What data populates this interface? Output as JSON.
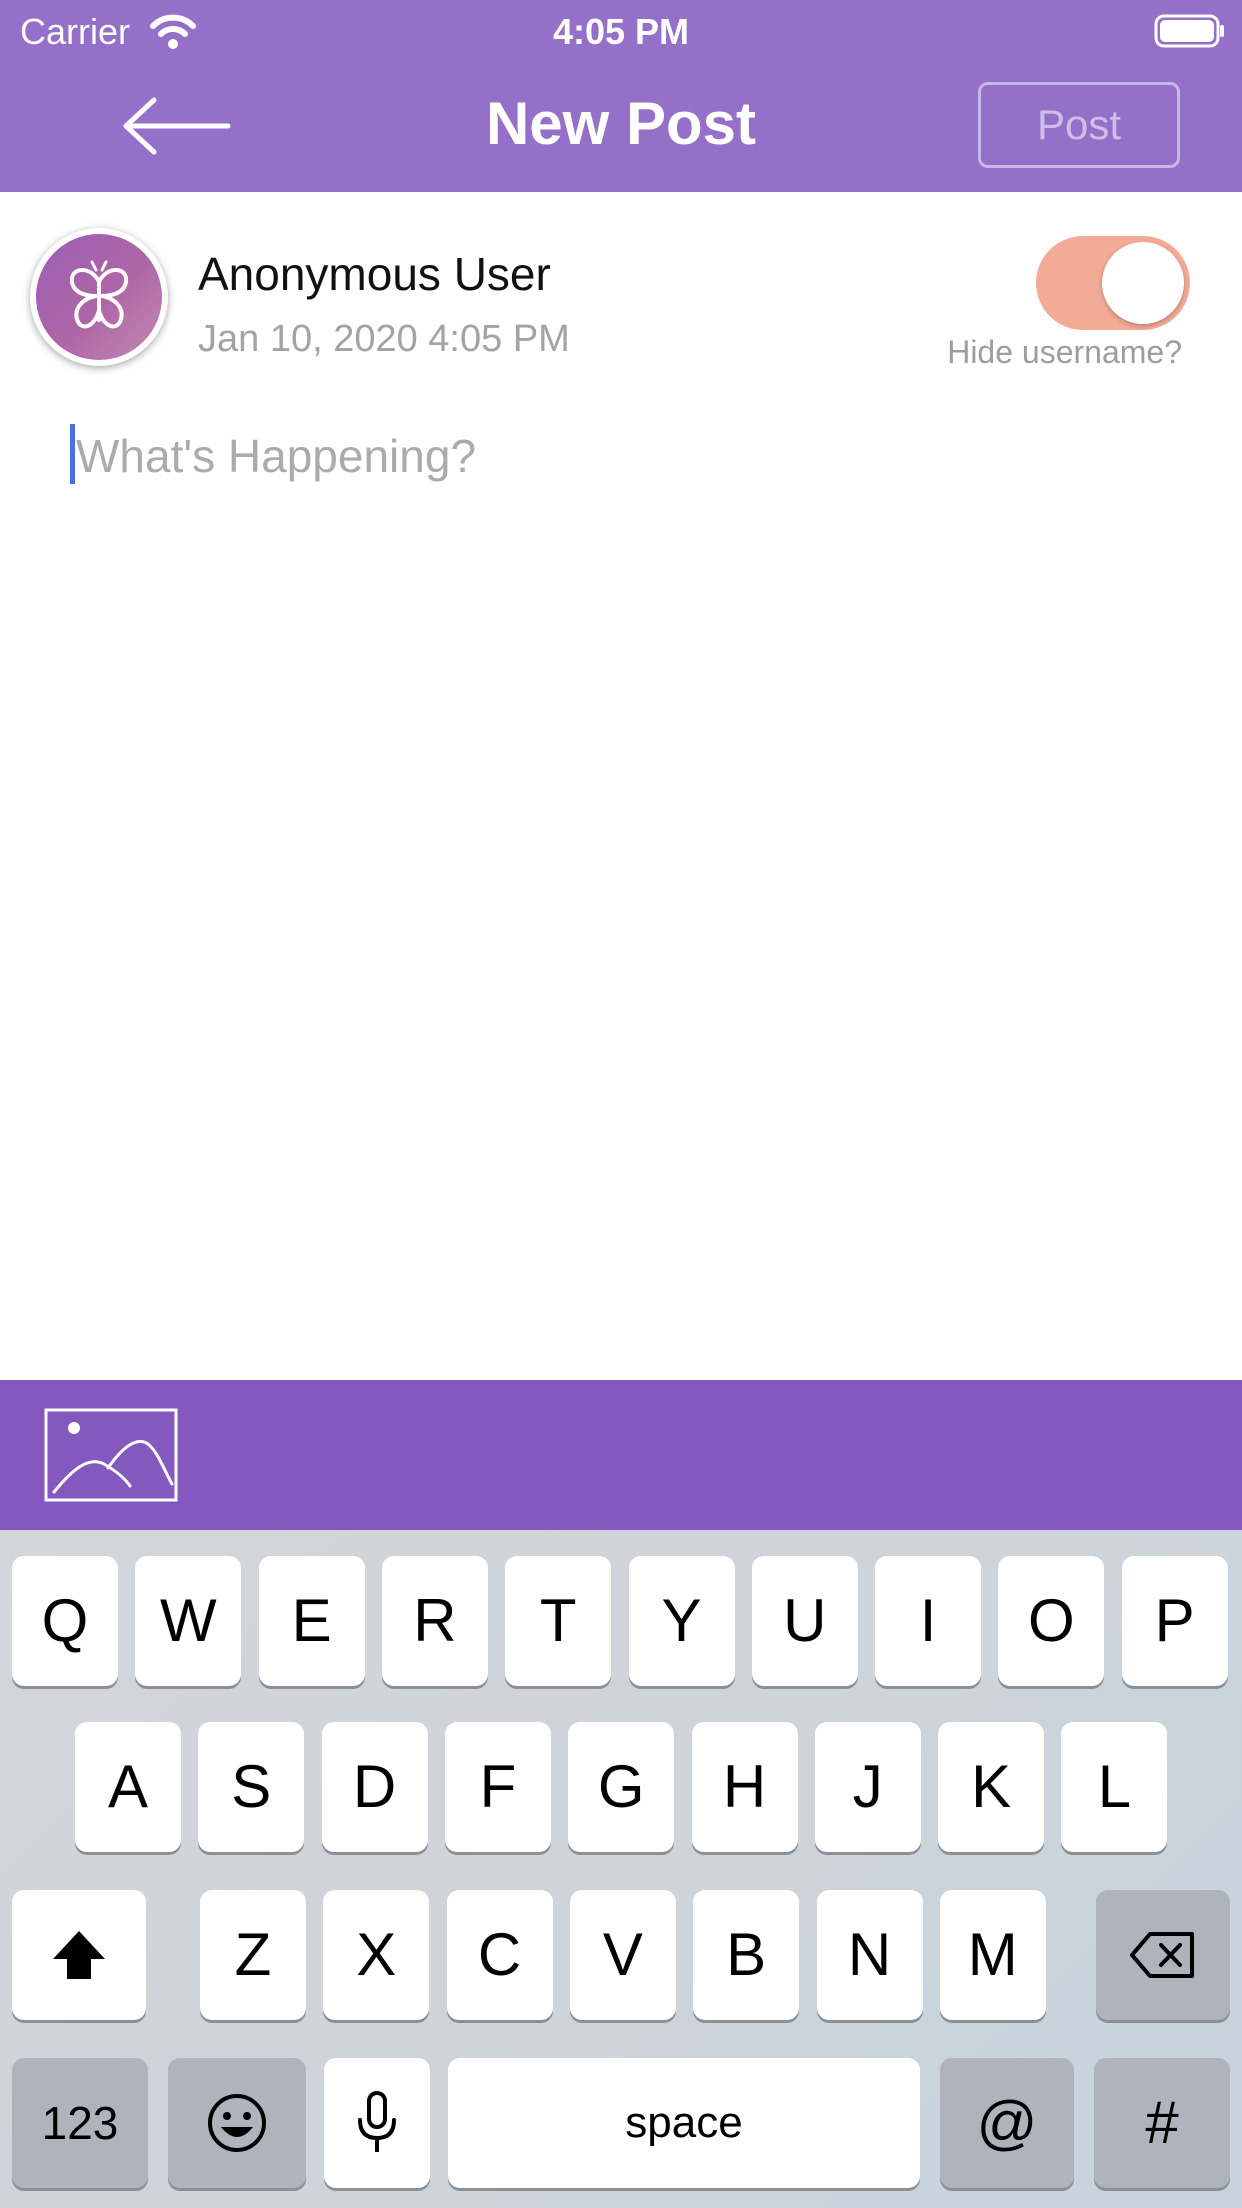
{
  "status_bar": {
    "carrier": "Carrier",
    "time": "4:05 PM"
  },
  "header": {
    "title": "New Post",
    "post_label": "Post"
  },
  "user": {
    "name": "Anonymous User",
    "timestamp": "Jan 10, 2020 4:05 PM",
    "hide_username_label": "Hide username?",
    "hide_username_on": true
  },
  "composer": {
    "placeholder": "What's Happening?"
  },
  "keyboard": {
    "row1": [
      "Q",
      "W",
      "E",
      "R",
      "T",
      "Y",
      "U",
      "I",
      "O",
      "P"
    ],
    "row2": [
      "A",
      "S",
      "D",
      "F",
      "G",
      "H",
      "J",
      "K",
      "L"
    ],
    "row3": [
      "Z",
      "X",
      "C",
      "V",
      "B",
      "N",
      "M"
    ],
    "numbers_label": "123",
    "space_label": "space",
    "at_label": "@",
    "hash_label": "#"
  },
  "colors": {
    "header": "#9570c8",
    "toolbar": "#8358bf",
    "toggle_on": "#f3ab97",
    "caret": "#4a6fe0"
  }
}
